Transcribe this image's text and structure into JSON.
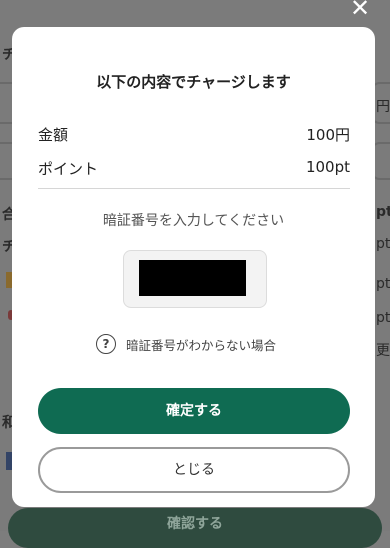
{
  "modal": {
    "title": "以下の内容でチャージします",
    "amount_label": "金額",
    "amount_value": "100円",
    "points_label": "ポイント",
    "points_value": "100pt",
    "pin_prompt": "暗証番号を入力してください",
    "pin_help": "暗証番号がわからない場合",
    "help_icon": "?",
    "confirm_label": "確定する",
    "close_label": "とじる"
  },
  "close_icon": "✕",
  "background": {
    "side_left_1": "チ",
    "side_left_2": "合",
    "side_left_3": "チ",
    "side_left_4": "和",
    "side_right_1": "円",
    "side_right_2": "pt",
    "side_right_3": "pt",
    "side_right_4": "pt",
    "side_right_5": "pt",
    "side_right_6": "更",
    "bottom_button_label": "確認する"
  }
}
